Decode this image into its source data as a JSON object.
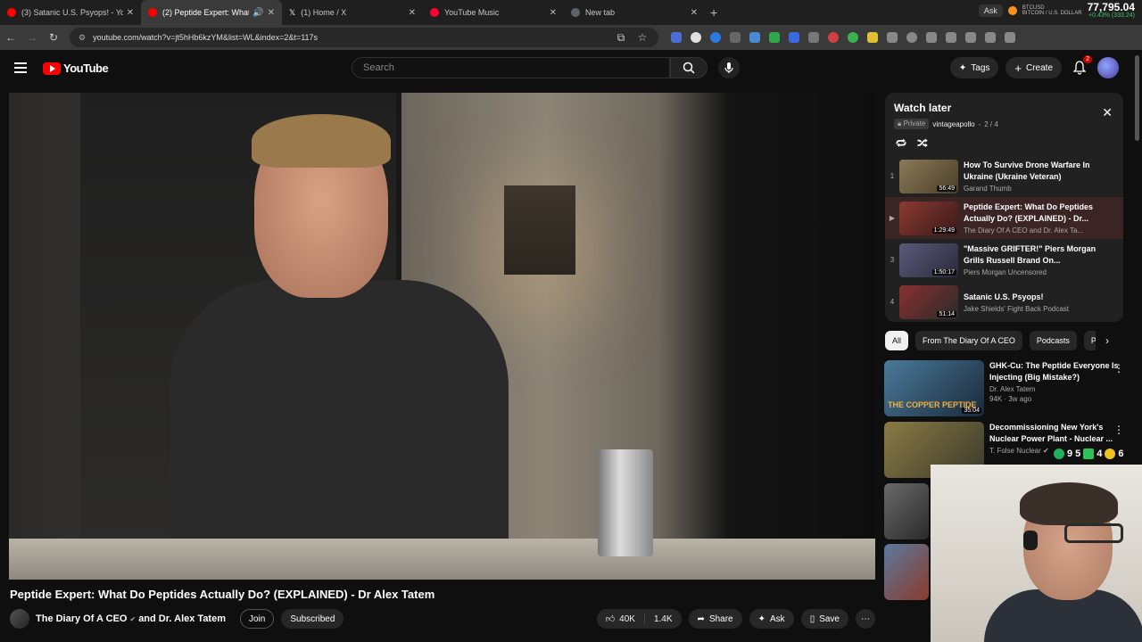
{
  "browser": {
    "tabs": [
      {
        "title": "(3) Satanic U.S. Psyops! - YouTube",
        "favicon_color": "#ff0000",
        "active": false
      },
      {
        "title": "(2) Peptide Expert: What Do Peptides",
        "favicon_color": "#ff0000",
        "active": true
      },
      {
        "title": "(1) Home / X",
        "favicon_color": "#ffffff",
        "active": false
      },
      {
        "title": "YouTube Music",
        "favicon_color": "#ff0033",
        "active": false
      },
      {
        "title": "New tab",
        "favicon_color": "#5f6368",
        "active": false
      }
    ],
    "url": "youtube.com/watch?v=jt5hHb6kzYM&list=WL&index=2&t=117s",
    "ticker": {
      "ask_label": "Ask",
      "symbol": "BTCUSD",
      "pair_name": "BITCOIN / U.S. DOLLAR",
      "price": "77,795.04",
      "change": "+0.43% (333.24)"
    }
  },
  "youtube": {
    "logo_text": "YouTube",
    "search_placeholder": "Search",
    "tags_label": "Tags",
    "create_label": "Create",
    "notification_count": "2"
  },
  "video": {
    "title": "Peptide Expert: What Do Peptides Actually Do? (EXPLAINED) - Dr Alex Tatem",
    "channel": "The Diary Of A CEO",
    "channel_join": "and Dr. Alex Tatem",
    "join_label": "Join",
    "subscribed_label": "Subscribed",
    "likes": "40K",
    "dislikes": "1.4K",
    "share_label": "Share",
    "ask_label": "Ask",
    "save_label": "Save"
  },
  "watch_later": {
    "title": "Watch later",
    "privacy": "Private",
    "owner": "vintageapollo",
    "position": "2 / 4",
    "items": [
      {
        "index": "1",
        "title": "How To Survive Drone Warfare In Ukraine (Ukraine Veteran)",
        "channel": "Garand Thumb",
        "duration": "56:49",
        "thumb_color": "#7a6a4a"
      },
      {
        "index": "▶",
        "title": "Peptide Expert: What Do Peptides Actually Do? (EXPLAINED) - Dr...",
        "channel": "The Diary Of A CEO and Dr. Alex Ta...",
        "duration": "1:29:49",
        "thumb_color": "#6b3030"
      },
      {
        "index": "3",
        "title": "\"Massive GRIFTER!\" Piers Morgan Grills Russell Brand On...",
        "channel": "Piers Morgan Uncensored",
        "duration": "1:50:17",
        "thumb_color": "#4a4a6a"
      },
      {
        "index": "4",
        "title": "Satanic U.S. Psyops!",
        "channel": "Jake Shields' Fight Back Podcast",
        "duration": "51:14",
        "thumb_color": "#6a2a2a"
      }
    ]
  },
  "chips": [
    "All",
    "From The Diary Of A CEO",
    "Podcasts",
    "P"
  ],
  "recommendations": [
    {
      "title": "GHK-Cu: The Peptide Everyone Is Injecting (Big Mistake?)",
      "channel": "Dr. Alex Tatem",
      "meta": "94K · 3w ago",
      "duration": "35:04",
      "caption": "THE COPPER PEPTIDE",
      "thumb_color": "#3a6a8a"
    },
    {
      "title": "Decommissioning New York's Nuclear Power Plant - Nuclear ...",
      "channel": "T. Folse Nuclear",
      "meta": "",
      "duration": "",
      "caption": "",
      "thumb_color": "#7a7040"
    }
  ],
  "overlay": {
    "a": "9",
    "b": "5",
    "c": "4",
    "d": "6"
  }
}
